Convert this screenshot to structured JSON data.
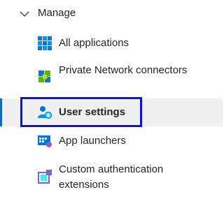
{
  "group": {
    "label": "Manage",
    "chevron_icon": "chevron-down-icon"
  },
  "items": [
    {
      "label": "All applications",
      "icon": "grid-apps-icon",
      "selected": false
    },
    {
      "label": "Private Network connectors",
      "icon": "network-connector-icon",
      "selected": false
    },
    {
      "label": "User settings",
      "icon": "user-settings-icon",
      "selected": true
    },
    {
      "label": "App launchers",
      "icon": "app-launcher-icon",
      "selected": false
    },
    {
      "label": "Custom authentication extensions",
      "icon": "custom-extension-icon",
      "selected": false
    }
  ],
  "colors": {
    "selection_background": "#f0f0f0",
    "selection_accent": "#0f6cbd",
    "highlight_border": "#0a14e6",
    "icon_blue": "#0078d4",
    "icon_green": "#5db300",
    "icon_purple": "#8661c5",
    "icon_teal": "#50e6ff"
  }
}
